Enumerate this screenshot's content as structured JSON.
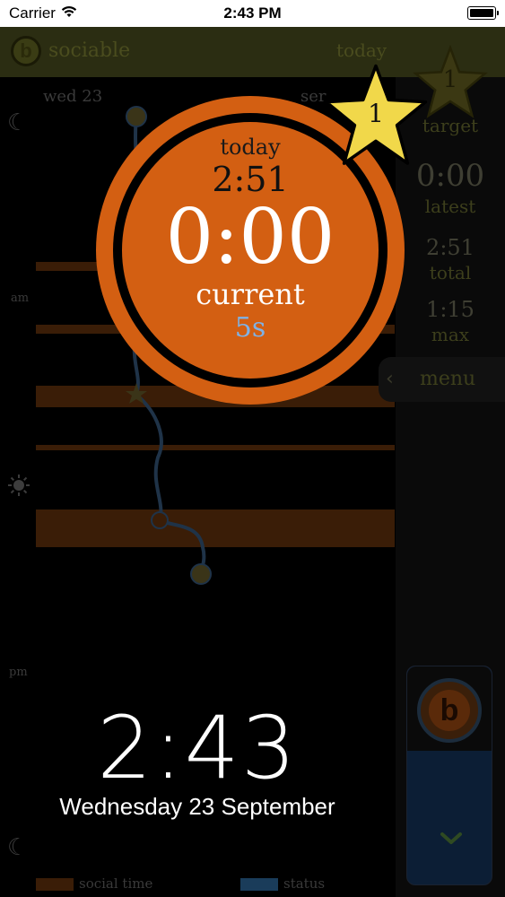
{
  "status_bar": {
    "carrier": "Carrier",
    "time": "2:43 PM"
  },
  "app_bar": {
    "logo_letter": "b",
    "app_name": "sociable",
    "view_label": "today"
  },
  "timeline": {
    "date_label": "wed 23",
    "date_label_right": "ser",
    "am_label": "am",
    "pm_label": "pm"
  },
  "dial": {
    "today_label": "today",
    "today_total": "2:51",
    "current_value": "0:00",
    "current_label": "current",
    "duration": "5s"
  },
  "badge": {
    "count": "1"
  },
  "right_panel": {
    "target_count": "1",
    "target_label": "target",
    "latest_value": "0:00",
    "latest_label": "latest",
    "total_value": "2:51",
    "total_label": "total",
    "max_value": "1:15",
    "max_label": "max",
    "menu_label": "menu"
  },
  "lock_screen": {
    "time": "2:43",
    "date": "Wednesday 23 September"
  },
  "legend": [
    {
      "label": "social time",
      "color": "#3a1d07"
    },
    {
      "label": "status",
      "color": "#1a3c5a"
    }
  ],
  "colors": {
    "accent": "#d35f12",
    "star": "#f1d84a",
    "duration": "#7fb2e6"
  }
}
